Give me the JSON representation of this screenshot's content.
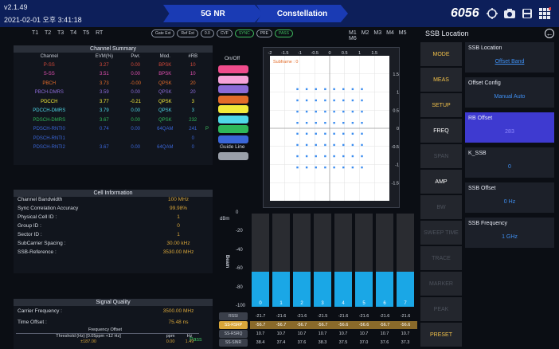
{
  "header": {
    "version": "v2.1.49",
    "datetime": "2021-02-01 오후 3:41:18",
    "tabs": [
      "5G NR",
      "Constellation"
    ],
    "frequency_badge": "6056",
    "icons": [
      "target-icon",
      "camera-icon",
      "save-icon",
      "grid-menu-icon"
    ]
  },
  "toolbar": {
    "traces": [
      "T1",
      "T2",
      "T3",
      "T4",
      "T5",
      "RT"
    ],
    "pills": [
      "Gate Ext",
      "Ref Ext",
      "0.0",
      "CVF",
      "SYNC",
      "PRE",
      "PASS"
    ],
    "markers": [
      "M1",
      "M2",
      "M3",
      "M4",
      "M5",
      "M6"
    ],
    "right_title": "SSB Location"
  },
  "channel_summary": {
    "title": "Channel Summary",
    "columns": [
      "Channel",
      "EVM(%)",
      "Pwr.",
      "Mod.",
      "#RB"
    ],
    "rows": [
      {
        "channel": "P-SS",
        "evm": "3.27",
        "pwr": "0.00",
        "mod": "BPSK",
        "rb": "10",
        "color": "#d6493a",
        "extra": ""
      },
      {
        "channel": "S-SS",
        "evm": "3.51",
        "pwr": "0.00",
        "mod": "BPSK",
        "rb": "10",
        "color": "#e04fb0",
        "extra": ""
      },
      {
        "channel": "PBCH",
        "evm": "3.73",
        "pwr": "-0.00",
        "mod": "QPSK",
        "rb": "20",
        "color": "#e36c2a",
        "extra": ""
      },
      {
        "channel": "PBCH-DMRS",
        "evm": "3.59",
        "pwr": "0.00",
        "mod": "QPSK",
        "rb": "20",
        "color": "#8c6bd8",
        "extra": ""
      },
      {
        "channel": "PDCCH",
        "evm": "3.77",
        "pwr": "-0.21",
        "mod": "QPSK",
        "rb": "3",
        "color": "#f2ea3a",
        "extra": ""
      },
      {
        "channel": "PDCCH-DMRS",
        "evm": "3.79",
        "pwr": "0.00",
        "mod": "QPSK",
        "rb": "3",
        "color": "#4fd8e8",
        "extra": ""
      },
      {
        "channel": "PDSCH-DMRS",
        "evm": "3.67",
        "pwr": "0.00",
        "mod": "QPSK",
        "rb": "232",
        "color": "#2fb85a",
        "extra": ""
      },
      {
        "channel": "PDSCH-RNTI0",
        "evm": "0.74",
        "pwr": "0.00",
        "mod": "64QAM",
        "rb": "241",
        "color": "#3a66d8",
        "extra": "P"
      },
      {
        "channel": "PDSCH-RNTI1",
        "evm": "",
        "pwr": "",
        "mod": "",
        "rb": "0",
        "color": "#3a66d8",
        "extra": ""
      },
      {
        "channel": "PDSCH-RNTI2",
        "evm": "3.67",
        "pwr": "0.00",
        "mod": "64QAM",
        "rb": "0",
        "color": "#3a66d8",
        "extra": ""
      }
    ]
  },
  "cell_info": {
    "title": "Cell Information",
    "items": [
      {
        "label": "Channel Bandwidth",
        "value": "100 MHz"
      },
      {
        "label": "Sync Correlation Accuracy",
        "value": "99.98%"
      },
      {
        "label": "Physical Cell ID :",
        "value": "1"
      },
      {
        "label": "Group ID :",
        "value": "0"
      },
      {
        "label": "Sector ID :",
        "value": "1"
      },
      {
        "label": "SubCarrier Spacing :",
        "value": "30.00 kHz"
      },
      {
        "label": "SSB-Reference :",
        "value": "3530.00 MHz"
      }
    ]
  },
  "signal_quality": {
    "title": "Signal Quality",
    "items": [
      {
        "label": "Carrier Frequency :",
        "value": "3500.00 MHz"
      },
      {
        "label": "Time Offset :",
        "value": "75.48 ns"
      }
    ],
    "freq_offset_title": "Frequency Offset",
    "fo_columns": [
      "Threshold (Hz) [0.05ppm +12 Hz]",
      "ppm",
      "Hz"
    ],
    "fo_values": [
      "±187.00",
      "0.00",
      "1.49"
    ],
    "fo_status": "Pass"
  },
  "legend": {
    "title": "On/Off",
    "swatches": [
      "#f04c8c",
      "#f7a3d8",
      "#8c6bd8",
      "#e36c2a",
      "#f2ea3a",
      "#4fd8e8",
      "#2fb85a",
      "#3a66d8"
    ],
    "guide_label": "Guide Line",
    "guide_color": "#9aa0aa"
  },
  "constellation": {
    "x_ticks": [
      "-2",
      "-1.5",
      "-1",
      "-0.5",
      "0",
      "0.5",
      "1",
      "1.5"
    ],
    "y_ticks": [
      "2",
      "1.5",
      "1",
      "0.5",
      "0",
      "-0.5",
      "-1",
      "-1.5",
      "-2"
    ],
    "subframe_label": "Subframe : 0",
    "point_color": "#3a8cf0"
  },
  "beam": {
    "y_unit": "dBm",
    "y_label": "Beam",
    "y_ticks": [
      "0",
      "-20",
      "-40",
      "-60",
      "-80",
      "-100"
    ],
    "ymin": -100,
    "ymax": 0,
    "beams": [
      "0",
      "1",
      "2",
      "3",
      "4",
      "5",
      "6",
      "7"
    ],
    "levels": [
      -62,
      -62,
      -62,
      -62,
      -62,
      -62,
      -62,
      -62
    ],
    "rows": [
      {
        "label": "RSSI",
        "values": [
          "-21.7",
          "-21.6",
          "-21.6",
          "-21.5",
          "-21.6",
          "-21.6",
          "-21.6",
          "-21.6"
        ],
        "label_bg": "#3a3f4a",
        "value_color": "#d6dbe3"
      },
      {
        "label": "SS-RSRP",
        "values": [
          "-56.7",
          "-56.7",
          "-56.7",
          "-56.7",
          "-56.6",
          "-56.6",
          "-56.7",
          "-56.6"
        ],
        "label_bg": "#d8a63a",
        "value_color": "#ffffff"
      },
      {
        "label": "SS-RSRQ",
        "values": [
          "10.7",
          "10.7",
          "10.7",
          "10.7",
          "10.7",
          "10.7",
          "10.7",
          "10.7"
        ],
        "label_bg": "#3a3f4a",
        "value_color": "#d6dbe3"
      },
      {
        "label": "SS-SINR",
        "values": [
          "38.4",
          "37.4",
          "37.6",
          "38.3",
          "37.5",
          "37.0",
          "37.6",
          "37.3"
        ],
        "label_bg": "#3a3f4a",
        "value_color": "#d6dbe3"
      }
    ]
  },
  "softkeys": [
    {
      "label": "MODE",
      "style": "yellow"
    },
    {
      "label": "MEAS",
      "style": "yellow"
    },
    {
      "label": "SETUP",
      "style": "yellow"
    },
    {
      "label": "FREQ",
      "style": "white"
    },
    {
      "label": "SPAN",
      "style": "dim"
    },
    {
      "label": "AMP",
      "style": "white"
    },
    {
      "label": "BW",
      "style": "dim"
    },
    {
      "label": "SWEEP TIME",
      "style": "dim"
    },
    {
      "label": "TRACE",
      "style": "dim"
    },
    {
      "label": "MARKER",
      "style": "dim"
    },
    {
      "label": "PEAK",
      "style": "dim"
    },
    {
      "label": "PRESET",
      "style": "yellow"
    }
  ],
  "params": [
    {
      "label": "SSB Location",
      "value": "Offset Band",
      "active": false,
      "underline": true
    },
    {
      "label": "Offset Config",
      "value": "Manual Auto",
      "active": false,
      "underline": false
    },
    {
      "label": "RB Offset",
      "value": "283",
      "active": true,
      "underline": false
    },
    {
      "label": "K_SSB",
      "value": "0",
      "active": false,
      "underline": false
    },
    {
      "label": "SSB Offset",
      "value": "0 Hz",
      "active": false,
      "underline": false
    },
    {
      "label": "SSB Frequency",
      "value": "1 GHz",
      "active": false,
      "underline": false
    }
  ],
  "colors": {
    "accent_blue": "#1a3bb4",
    "value_gold": "#d8a63a",
    "active_param": "#3e3ad0",
    "bar_fill": "#1aa7e6"
  }
}
